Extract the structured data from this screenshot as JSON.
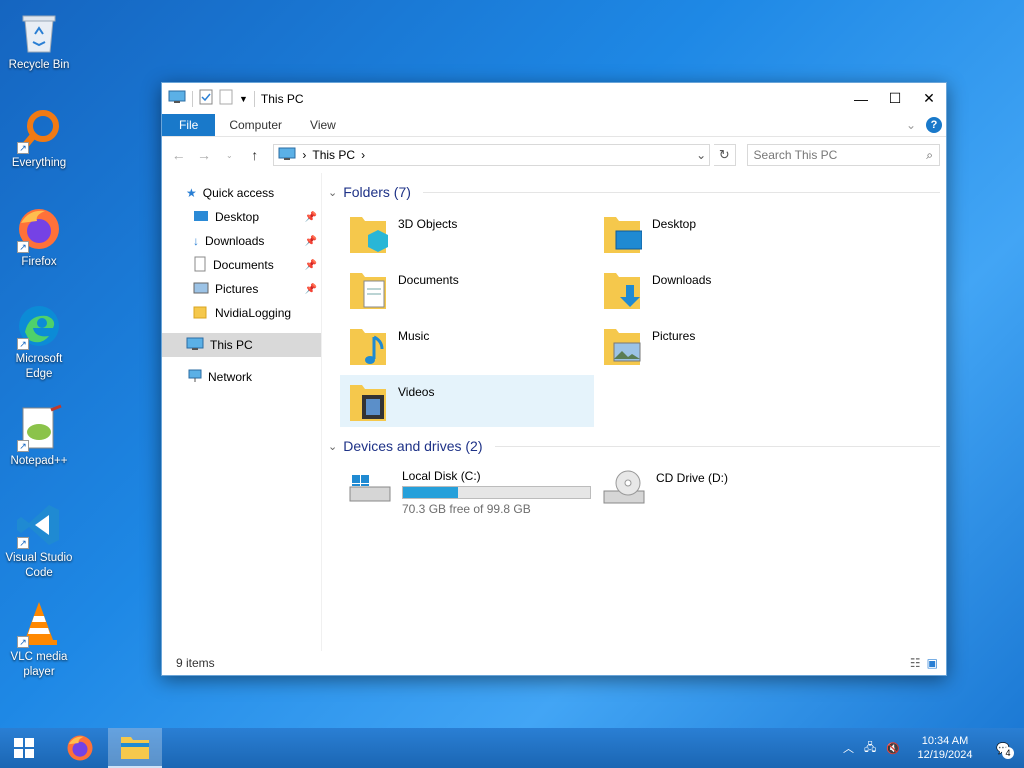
{
  "desktop": {
    "icons": [
      {
        "label": "Recycle Bin"
      },
      {
        "label": "Everything"
      },
      {
        "label": "Firefox"
      },
      {
        "label": "Microsoft Edge"
      },
      {
        "label": "Notepad++"
      },
      {
        "label": "Visual Studio Code"
      },
      {
        "label": "VLC media player"
      }
    ]
  },
  "explorer": {
    "title": "This PC",
    "ribbon": {
      "file": "File",
      "computer": "Computer",
      "view": "View",
      "help": "?"
    },
    "address": {
      "path": "This PC"
    },
    "search": {
      "placeholder": "Search This PC"
    },
    "nav": {
      "quick_access": "Quick access",
      "items": [
        {
          "label": "Desktop"
        },
        {
          "label": "Downloads"
        },
        {
          "label": "Documents"
        },
        {
          "label": "Pictures"
        },
        {
          "label": "NvidiaLogging"
        }
      ],
      "this_pc": "This PC",
      "network": "Network"
    },
    "folders": {
      "heading": "Folders (7)",
      "items": [
        {
          "label": "3D Objects"
        },
        {
          "label": "Desktop"
        },
        {
          "label": "Documents"
        },
        {
          "label": "Downloads"
        },
        {
          "label": "Music"
        },
        {
          "label": "Pictures"
        },
        {
          "label": "Videos"
        }
      ]
    },
    "drives": {
      "heading": "Devices and drives (2)",
      "local": {
        "label": "Local Disk (C:)",
        "free_text": "70.3 GB free of 99.8 GB",
        "used_fraction": 0.296
      },
      "cd": {
        "label": "CD Drive (D:)"
      }
    },
    "status": {
      "items": "9 items"
    }
  },
  "taskbar": {
    "time": "10:34 AM",
    "date": "12/19/2024",
    "notification_count": "4"
  },
  "colors": {
    "accent": "#1979ca",
    "folder": "#f5c84c",
    "taskbar": "#1f6fc0"
  }
}
